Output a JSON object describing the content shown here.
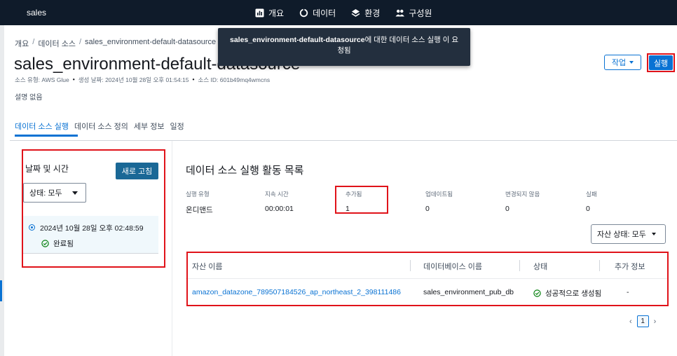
{
  "nav": {
    "brand": "sales",
    "items": [
      {
        "label": "개요",
        "icon": "chart-icon"
      },
      {
        "label": "데이터",
        "icon": "data-ring-icon"
      },
      {
        "label": "환경",
        "icon": "layers-icon"
      },
      {
        "label": "구성원",
        "icon": "users-icon"
      }
    ]
  },
  "breadcrumb": [
    "개요",
    "데이터 소스",
    "sales_environment-default-datasource"
  ],
  "page": {
    "title": "sales_environment-default-datasource",
    "meta": {
      "source_type": "소스 유형: AWS Glue",
      "created": "생성 날짜: 2024년 10월 28일 오후 01:54:15",
      "source_id": "소스 ID: 601b49mq4wmcns"
    },
    "description": "설명 없음"
  },
  "toast": {
    "name": "sales_environment-default-datasource",
    "message": "에 대한 데이터 소스 실행 이 요청됨"
  },
  "actions": {
    "actions_label": "작업",
    "run_label": "실행"
  },
  "tabs": [
    "데이터 소스 실행",
    "데이터 소스 정의",
    "세부 정보",
    "일정"
  ],
  "left": {
    "title": "날짜 및 시간",
    "refresh_label": "새로 고침",
    "status_filter": "상태: 모두",
    "run": {
      "date": "2024년 10월 28일 오후 02:48:59",
      "status": "완료됨"
    }
  },
  "right": {
    "title": "데이터 소스 실행 활동 목록",
    "stats": [
      {
        "label": "실행 유형",
        "value": "온디맨드"
      },
      {
        "label": "지속 시간",
        "value": "00:00:01"
      },
      {
        "label": "추가됨",
        "value": "1"
      },
      {
        "label": "업데이트됨",
        "value": "0"
      },
      {
        "label": "변경되지 않음",
        "value": "0"
      },
      {
        "label": "실패",
        "value": "0"
      }
    ],
    "asset_filter": "자산 상태: 모두",
    "table": {
      "headers": [
        "자산 이름",
        "데이터베이스 이름",
        "상태",
        "추가 정보"
      ],
      "rows": [
        {
          "asset": "amazon_datazone_789507184526_ap_northeast_2_398111486",
          "database": "sales_environment_pub_db",
          "status": "성공적으로 생성됨",
          "info": "-"
        }
      ]
    },
    "page": "1"
  },
  "colors": {
    "nav_bg": "#0f1b2a",
    "accent": "#0972d3",
    "highlight": "#e0131a",
    "success": "#037f0c"
  }
}
